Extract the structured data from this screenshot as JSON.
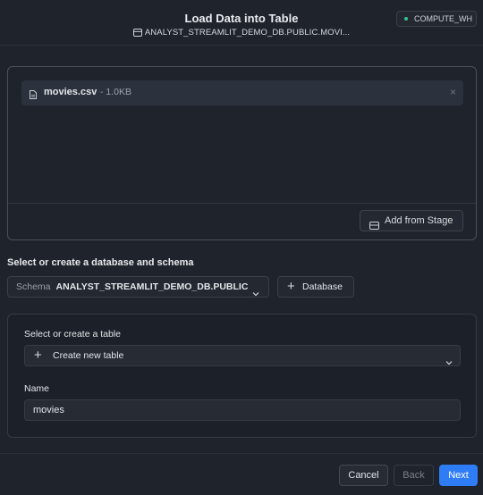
{
  "header": {
    "title": "Load Data into Table",
    "target_path": "ANALYST_STREAMLIT_DEMO_DB.PUBLIC.MOVI...",
    "warehouse": "COMPUTE_WH",
    "warehouse_status_color": "#35c38f"
  },
  "upload": {
    "file_name": "movies.csv",
    "file_size": "- 1.0KB",
    "add_from_stage_label": "Add from Stage"
  },
  "database_section": {
    "label": "Select or create a database and schema",
    "schema_prefix": "Schema",
    "schema_value": "ANALYST_STREAMLIT_DEMO_DB.PUBLIC",
    "add_database_label": "Database"
  },
  "table_section": {
    "label": "Select or create a table",
    "table_option": "Create new table",
    "name_label": "Name",
    "name_value": "movies"
  },
  "footer": {
    "cancel_label": "Cancel",
    "back_label": "Back",
    "next_label": "Next",
    "primary_color": "#2f7df6"
  }
}
